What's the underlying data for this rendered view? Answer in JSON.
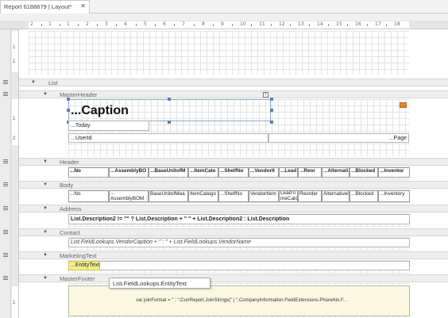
{
  "tab": {
    "title": "Report 6188679 | Layout*",
    "close": "✕"
  },
  "ruler": {
    "h_ticks": [
      "2",
      "1",
      "1",
      "2",
      "3",
      "4",
      "5",
      "6",
      "7",
      "8",
      "9",
      "10",
      "11",
      "12",
      "13",
      "14",
      "15",
      "16",
      "17",
      "18"
    ],
    "v_ticks_top": [
      "1",
      "1"
    ],
    "v_ticks_master": [
      "1",
      "2"
    ],
    "v_ticks_footer": [
      "1"
    ]
  },
  "bands": {
    "list": "List",
    "master_header": "MasterHeader",
    "header": "Header",
    "body": "Body",
    "address": "Address",
    "contact": "Contact",
    "marketing_text": "MarketingText",
    "master_footer": "MasterFooter"
  },
  "master_header": {
    "caption": "...Caption",
    "today": "...Today",
    "userid": "...UserId",
    "page": "...Page",
    "smart_tag": "›"
  },
  "header_cells": [
    "...No",
    "...AssemblyBO",
    "...BaseUnitofM",
    "...ItemCate",
    "...ShelfNo",
    "...VendorIt",
    "...Lead",
    "...Reor",
    "...Alternati",
    "...Blocked",
    "...Inventor"
  ],
  "body_cells": [
    "...No",
    "... AssemblyBOM",
    "BaseUnitofMea",
    "ItemCatego",
    "...ShelfNo",
    "VendorItem",
    "LeadTi meCalc",
    "Reorder",
    "Alternativel",
    "...Blocked",
    "...Inventory"
  ],
  "address_expr": "List.Description2 != \"\" ? List.Description + \" \" + List.Description2 : List.Description",
  "contact_expr": "List.FieldLookups.VendorCaption + \" : \" + List.FieldLookups.VendorName",
  "marketing_text": "...EntityText",
  "tooltip": "List.FieldLookups.EntityText",
  "footer_expr": "var joinFormat = \" : \";CurrReport.JoinStrings(\" | \",CompanyInformation.FieldExtensions.PhoneNo.F...",
  "colors": {
    "accent": "#5b7eb6",
    "highlight": "#f5f08c",
    "footer_bg": "#fbf8e2"
  }
}
